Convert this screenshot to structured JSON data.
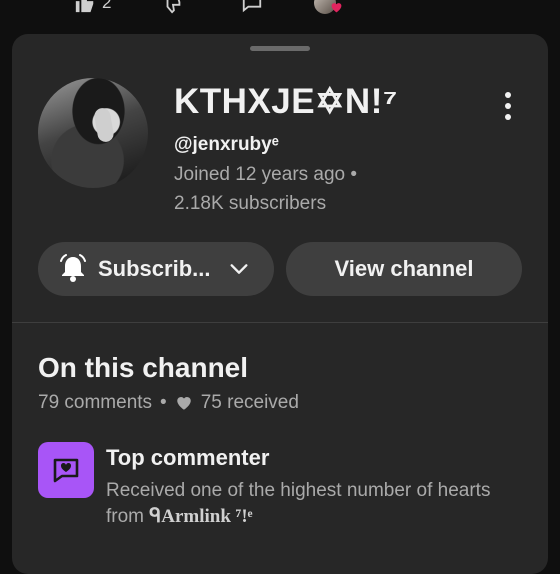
{
  "top_bar": {
    "like_count": "2",
    "icons": [
      "thumbs-up-icon",
      "thumbs-down-icon",
      "comment-icon",
      "avatar-heart"
    ]
  },
  "channel": {
    "name": "KTHXJE✡N!⁷",
    "handle": "@jenxrubyᵉ",
    "joined": "Joined 12 years ago •",
    "subscribers": "2.18K subscribers"
  },
  "buttons": {
    "subscribe_label": "Subscrib...",
    "view_channel_label": "View channel"
  },
  "on_this_channel": {
    "title": "On this channel",
    "comments": "79 comments",
    "separator": "•",
    "received": "75 received"
  },
  "top_commenter": {
    "title": "Top commenter",
    "description": "Received one of the highest number of hearts from",
    "from_user": "ᑫArmlink ⁷!ᵉ"
  },
  "colors": {
    "background": "#0f0f0f",
    "sheet": "#272727",
    "button": "#3f3f3f",
    "accent_purple": "#a855f7",
    "heart_red": "#e0245e",
    "secondary_text": "#aaaaaa"
  }
}
